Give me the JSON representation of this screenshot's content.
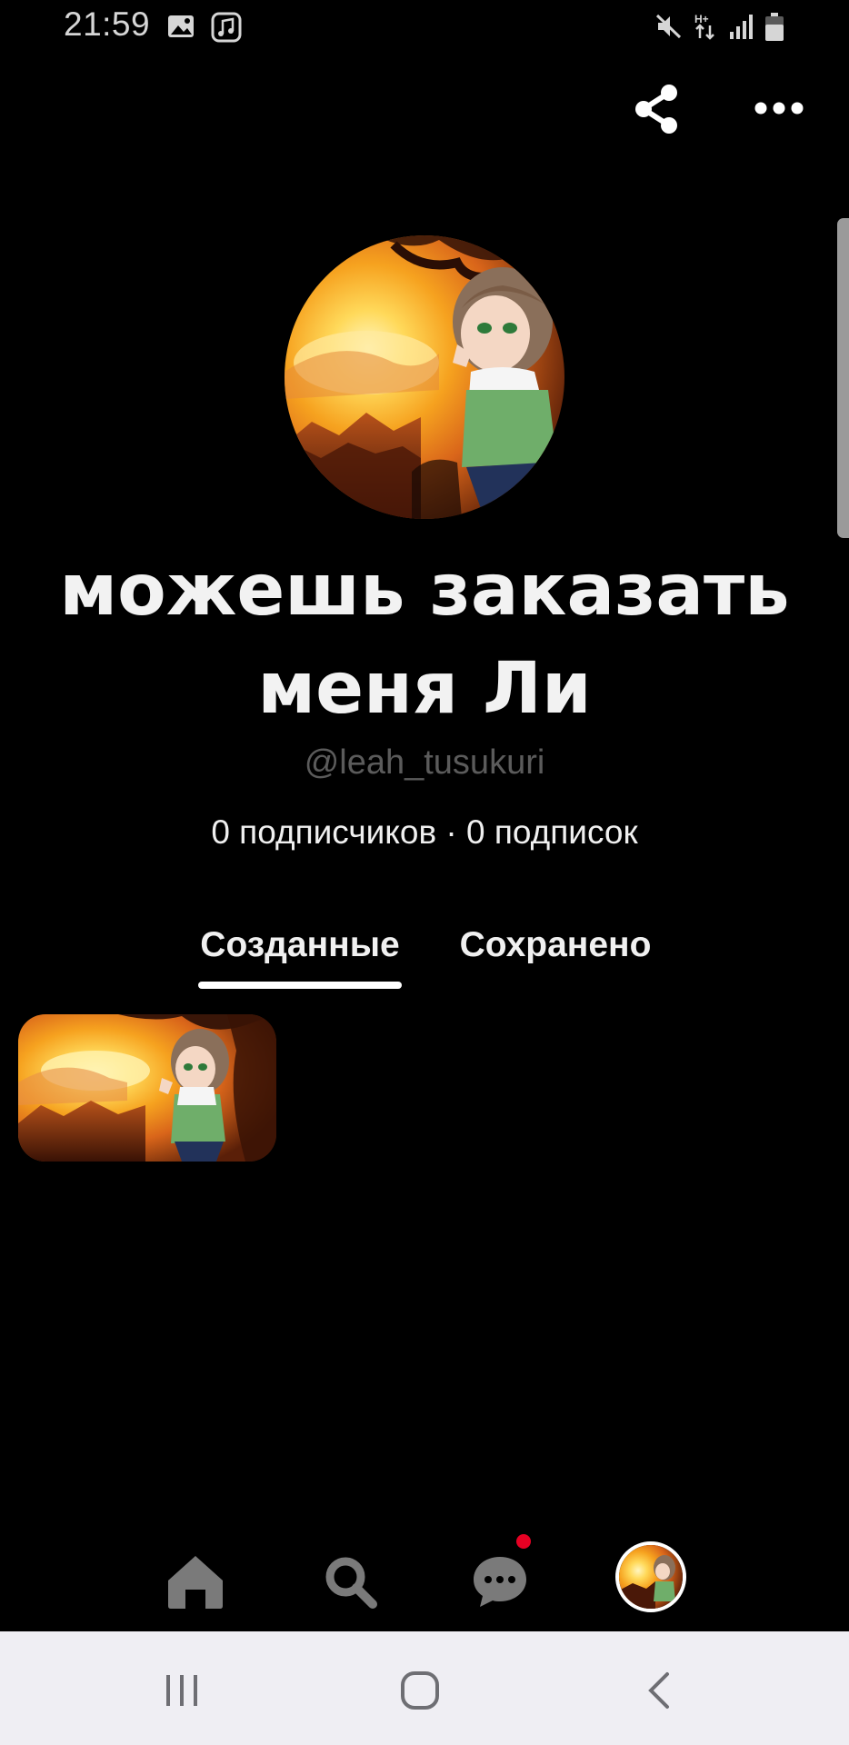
{
  "status_bar": {
    "time": "21:59",
    "icons": [
      "gallery-icon",
      "music-icon",
      "mute-icon",
      "hplus-data-icon",
      "signal-icon",
      "battery-icon"
    ]
  },
  "header": {
    "share_icon": "share-icon",
    "more_icon": "more-dots-icon"
  },
  "profile": {
    "name": "можешь заказать меня  Ли",
    "handle": "@leah_tusukuri",
    "stats": "0 подписчиков · 0 подписок"
  },
  "tabs": [
    {
      "label": "Созданные",
      "active": true
    },
    {
      "label": "Сохранено",
      "active": false
    }
  ],
  "pins": [
    {
      "type": "image"
    }
  ],
  "bottom_nav": {
    "items": [
      "home-icon",
      "search-icon",
      "messages-icon",
      "profile-avatar"
    ],
    "notification_color": "#e60023"
  },
  "system_nav": {
    "items": [
      "recent-apps-icon",
      "home-circle-icon",
      "back-icon"
    ]
  },
  "colors": {
    "background": "#000000",
    "text": "#f0f0f0",
    "handle": "#5b5b5b",
    "system_bar": "#efeef3"
  }
}
